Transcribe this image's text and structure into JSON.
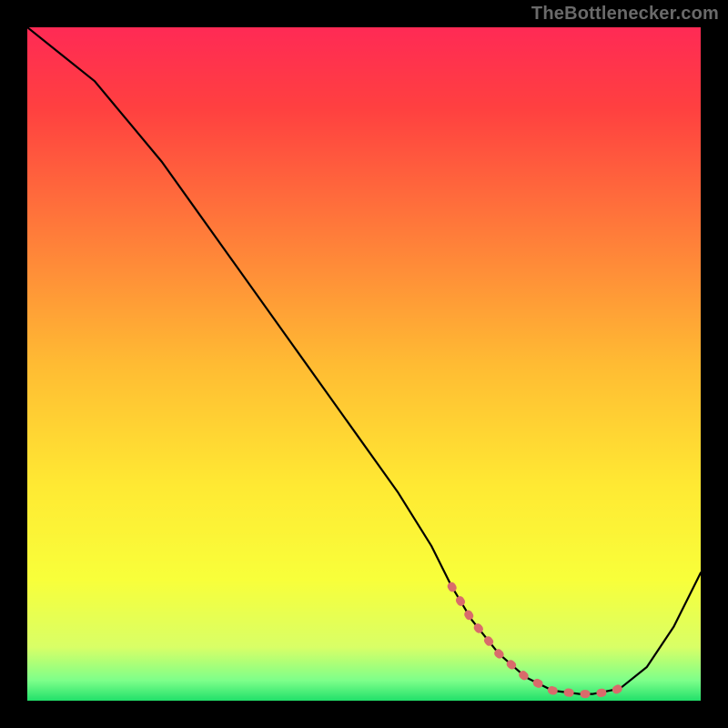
{
  "attribution": "TheBottlenecker.com",
  "chart_data": {
    "type": "line",
    "title": "",
    "xlabel": "",
    "ylabel": "",
    "xlim": [
      0,
      100
    ],
    "ylim": [
      0,
      100
    ],
    "background_gradient_stops": [
      {
        "offset": 0,
        "color": "#ff2a55"
      },
      {
        "offset": 0.12,
        "color": "#ff4040"
      },
      {
        "offset": 0.3,
        "color": "#ff7a3a"
      },
      {
        "offset": 0.5,
        "color": "#ffbb33"
      },
      {
        "offset": 0.68,
        "color": "#ffe933"
      },
      {
        "offset": 0.82,
        "color": "#f8ff3a"
      },
      {
        "offset": 0.92,
        "color": "#d9ff66"
      },
      {
        "offset": 0.97,
        "color": "#7dff8a"
      },
      {
        "offset": 1.0,
        "color": "#22e06a"
      }
    ],
    "series": [
      {
        "name": "bottleneck-curve",
        "stroke": "#000000",
        "stroke_width": 2.2,
        "x": [
          0,
          5,
          10,
          15,
          20,
          25,
          30,
          35,
          40,
          45,
          50,
          55,
          60,
          63,
          66,
          70,
          74,
          78,
          82,
          84,
          88,
          92,
          96,
          100
        ],
        "y": [
          100,
          96,
          92,
          86,
          80,
          73,
          66,
          59,
          52,
          45,
          38,
          31,
          23,
          17,
          12,
          7,
          3.5,
          1.5,
          1.0,
          1.0,
          1.8,
          5,
          11,
          19
        ]
      }
    ],
    "highlight_band": {
      "name": "optimal-range-marker",
      "stroke": "#d96b6b",
      "stroke_width": 9,
      "dash": "2 16",
      "linecap": "round",
      "x": [
        63,
        66,
        70,
        74,
        78,
        82,
        84,
        87,
        89
      ],
      "y": [
        17,
        12,
        7,
        3.5,
        1.5,
        1.0,
        1.0,
        1.4,
        2.4
      ]
    }
  }
}
